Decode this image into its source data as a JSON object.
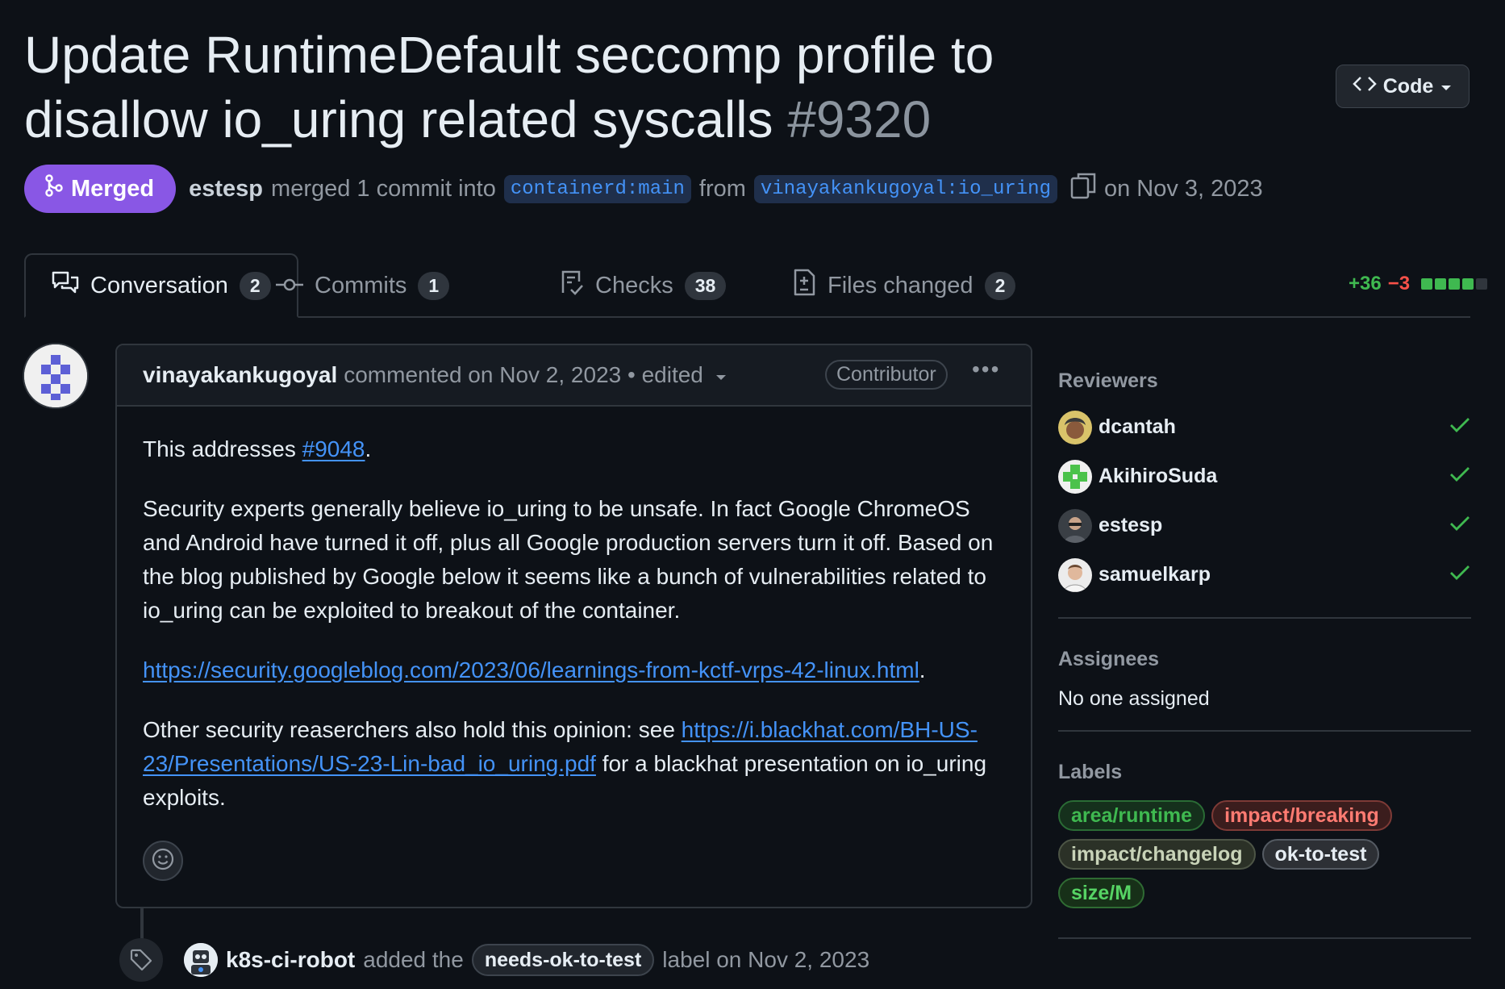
{
  "pr": {
    "title": "Update RuntimeDefault seccomp profile to disallow io_uring related syscalls",
    "number": "#9320",
    "code_button": "Code",
    "status": "Merged",
    "author": "estesp",
    "merged_text": "merged 1 commit into",
    "base_branch": "containerd:main",
    "from_text": "from",
    "head_branch": "vinayakankugoyal:io_uring",
    "date_text": "on Nov 3, 2023"
  },
  "tabs": [
    {
      "label": "Conversation",
      "count": "2",
      "icon": "comment-discussion-icon"
    },
    {
      "label": "Commits",
      "count": "1",
      "icon": "git-commit-icon"
    },
    {
      "label": "Checks",
      "count": "38",
      "icon": "checklist-icon"
    },
    {
      "label": "Files changed",
      "count": "2",
      "icon": "file-diff-icon"
    }
  ],
  "diffstat": {
    "additions": "+36",
    "deletions": "−3",
    "colors": [
      "#3fb950",
      "#3fb950",
      "#3fb950",
      "#3fb950",
      "#30363d"
    ]
  },
  "comment": {
    "author": "vinayakankugoyal",
    "meta": "commented on Nov 2, 2023 • edited",
    "role": "Contributor",
    "p1_prefix": "This addresses ",
    "p1_link": "#9048",
    "p1_suffix": ".",
    "p2": "Security experts generally believe io_uring to be unsafe. In fact Google ChromeOS and Android have turned it off, plus all Google production servers turn it off. Based on the blog published by Google below it seems like a bunch of vulnerabilities related to io_uring can be exploited to breakout of the container.",
    "p3_link": "https://security.googleblog.com/2023/06/learnings-from-kctf-vrps-42-linux.html",
    "p3_suffix": ".",
    "p4_prefix": "Other security reaserchers also hold this opinion: see ",
    "p4_link": "https://i.blackhat.com/BH-US-23/Presentations/US-23-Lin-bad_io_uring.pdf",
    "p4_suffix": " for a blackhat presentation on io_uring exploits."
  },
  "event": {
    "actor": "k8s-ci-robot",
    "action": "added the",
    "label": "needs-ok-to-test",
    "suffix": "label on Nov 2, 2023"
  },
  "sidebar": {
    "reviewers_heading": "Reviewers",
    "reviewers": [
      "dcantah",
      "AkihiroSuda",
      "estesp",
      "samuelkarp"
    ],
    "assignees_heading": "Assignees",
    "assignees_text": "No one assigned",
    "labels_heading": "Labels",
    "labels": [
      {
        "name": "area/runtime",
        "color": "#3fb950",
        "bg": "#15301c",
        "border": "#2a6b35"
      },
      {
        "name": "impact/breaking",
        "color": "#ff7b72",
        "bg": "#3b1d1d",
        "border": "#7d3a36"
      },
      {
        "name": "impact/changelog",
        "color": "#c8d3b8",
        "bg": "#2b3127",
        "border": "#4d5546"
      },
      {
        "name": "ok-to-test",
        "color": "#e6edf3",
        "bg": "#2d3035",
        "border": "#555b63"
      },
      {
        "name": "size/M",
        "color": "#56d364",
        "bg": "#173018",
        "border": "#2f6b33"
      }
    ]
  }
}
